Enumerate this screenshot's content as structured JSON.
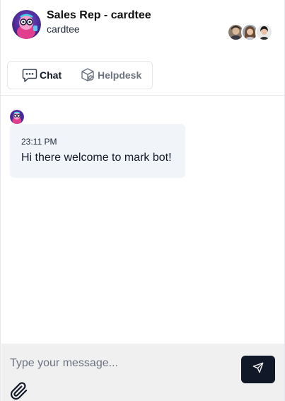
{
  "header": {
    "title": "Sales Rep - cardtee",
    "subtitle": "cardtee",
    "bot_avatar_icon": "robot-mascot-avatar",
    "team_avatars": [
      "agent-avatar-1",
      "agent-avatar-2",
      "agent-avatar-3"
    ]
  },
  "tabs": [
    {
      "label": "Chat",
      "icon": "chat-bubble-icon",
      "active": true
    },
    {
      "label": "Helpdesk",
      "icon": "helpdesk-box-icon",
      "active": false
    }
  ],
  "messages": [
    {
      "sender": "bot",
      "time": "23:11 PM",
      "text": "Hi there welcome to mark bot!"
    }
  ],
  "composer": {
    "placeholder": "Type your message...",
    "send_icon": "send-icon",
    "attach_icon": "paperclip-icon"
  },
  "colors": {
    "bubble_bg": "#f1f4f9",
    "composer_bg": "#f0f0f0",
    "send_bg": "#111827",
    "muted_text": "#6b7280"
  }
}
